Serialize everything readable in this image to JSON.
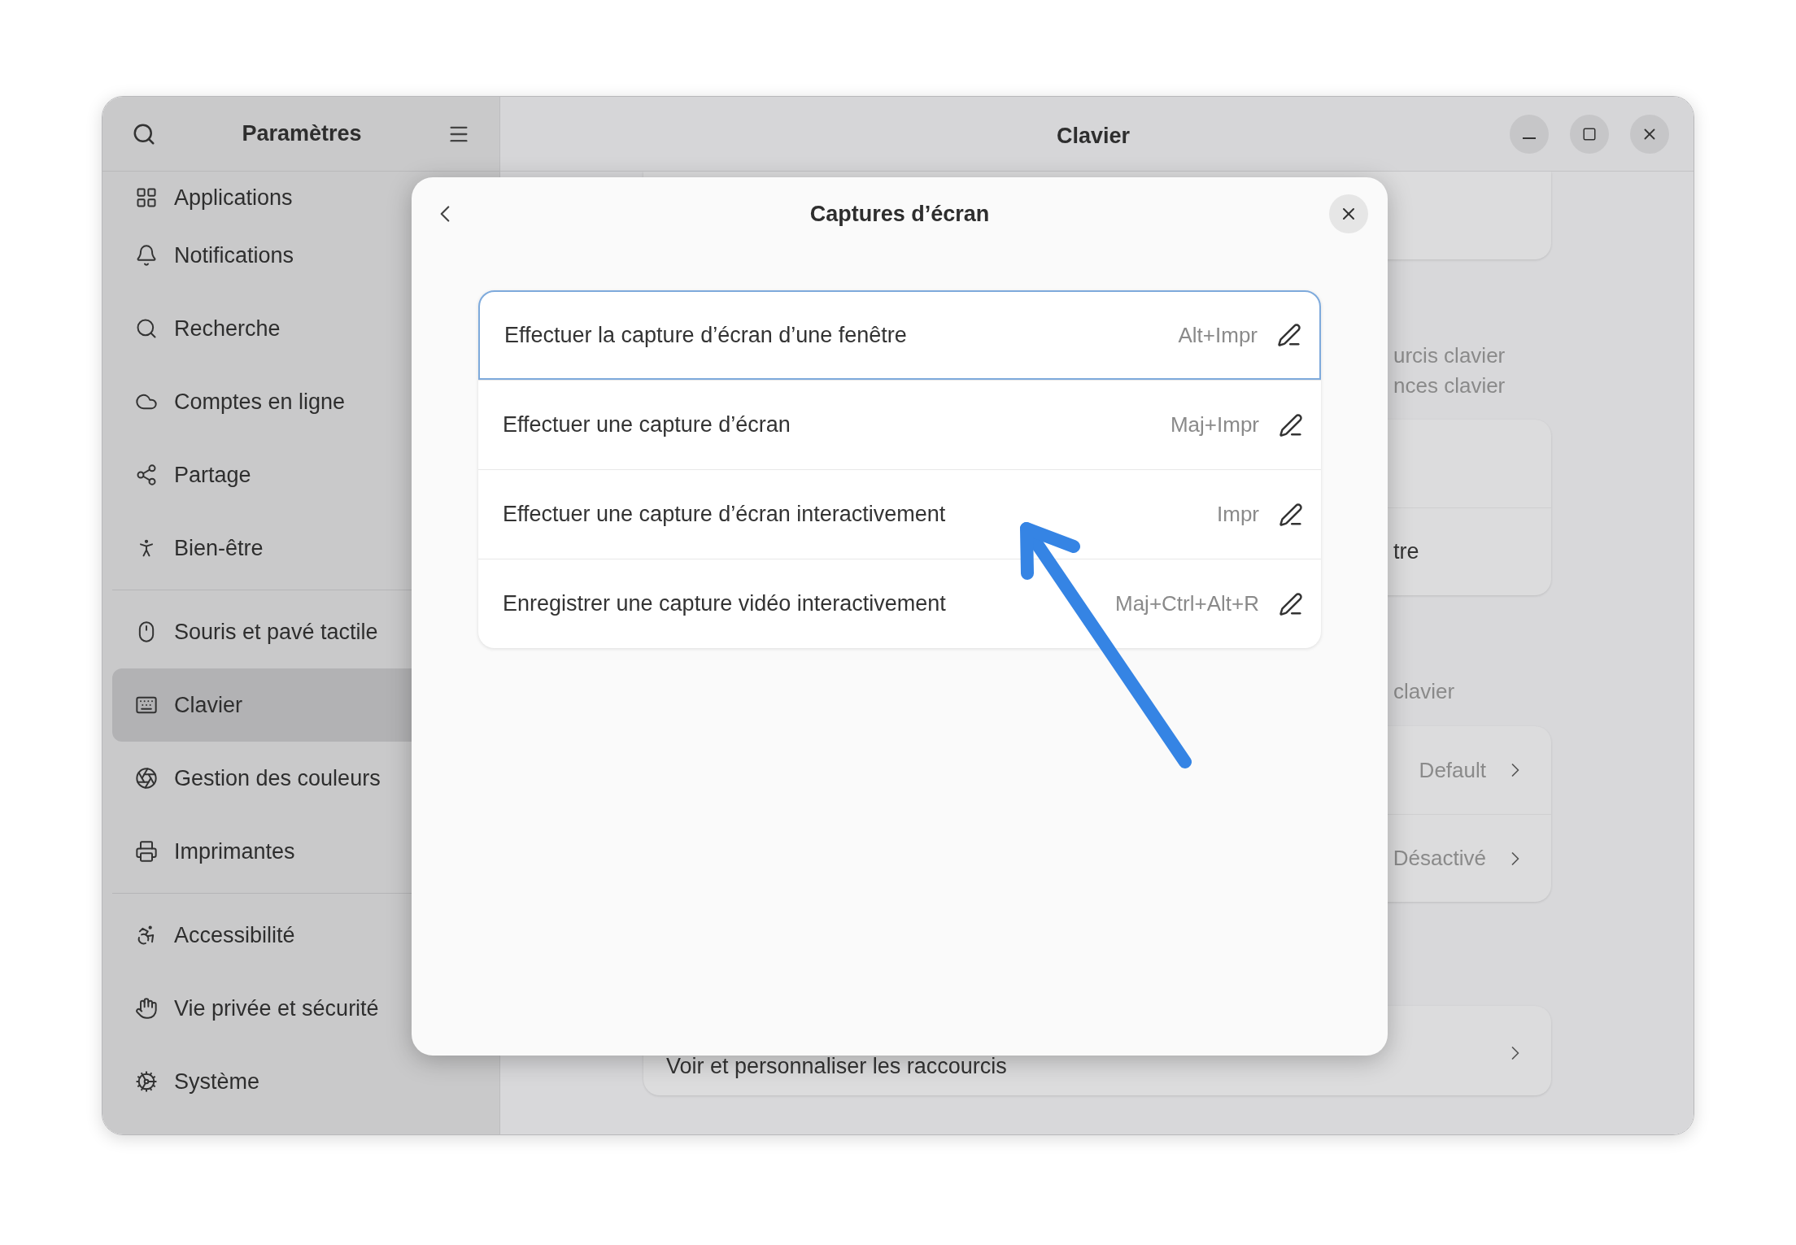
{
  "window": {
    "title": "Clavier"
  },
  "sidebar": {
    "title": "Paramètres",
    "groups": [
      [
        {
          "label": "Applications",
          "selected": false
        },
        {
          "label": "Notifications",
          "selected": false
        },
        {
          "label": "Recherche",
          "selected": false
        },
        {
          "label": "Comptes en ligne",
          "selected": false
        },
        {
          "label": "Partage",
          "selected": false
        },
        {
          "label": "Bien-être",
          "selected": false
        }
      ],
      [
        {
          "label": "Souris et pavé tactile",
          "selected": false
        },
        {
          "label": "Clavier",
          "selected": true
        },
        {
          "label": "Gestion des couleurs",
          "selected": false
        },
        {
          "label": "Imprimantes",
          "selected": false
        }
      ],
      [
        {
          "label": "Accessibilité",
          "selected": false
        },
        {
          "label": "Vie privée et sécurité",
          "selected": false
        },
        {
          "label": "Système",
          "selected": false
        }
      ]
    ]
  },
  "page": {
    "blocks": [
      {
        "kind": "card",
        "rows": [
          {
            "kind": "empty"
          }
        ]
      },
      {
        "kind": "caption",
        "lines": [
          "urcis clavier",
          "nces clavier"
        ]
      },
      {
        "kind": "card",
        "rows": [
          {
            "kind": "empty"
          },
          {
            "kind": "fragment",
            "label": "tre"
          }
        ]
      },
      {
        "kind": "caption",
        "lines": [
          "clavier"
        ]
      },
      {
        "kind": "card",
        "rows": [
          {
            "kind": "value",
            "value": "Default"
          },
          {
            "kind": "value",
            "value": "Désactivé"
          }
        ]
      },
      {
        "kind": "card",
        "rows": [
          {
            "kind": "link",
            "label": "Voir et personnaliser les raccourcis"
          }
        ]
      }
    ]
  },
  "dialog": {
    "title": "Captures d’écran",
    "shortcuts": [
      {
        "label": "Effectuer la capture d’écran d’une fenêtre",
        "accel": "Alt+Impr",
        "selected": true
      },
      {
        "label": "Effectuer une capture d’écran",
        "accel": "Maj+Impr",
        "selected": false
      },
      {
        "label": "Effectuer une capture d’écran interactivement",
        "accel": "Impr",
        "selected": false
      },
      {
        "label": "Enregistrer une capture vidéo interactivement",
        "accel": "Maj+Ctrl+Alt+R",
        "selected": false
      }
    ]
  }
}
